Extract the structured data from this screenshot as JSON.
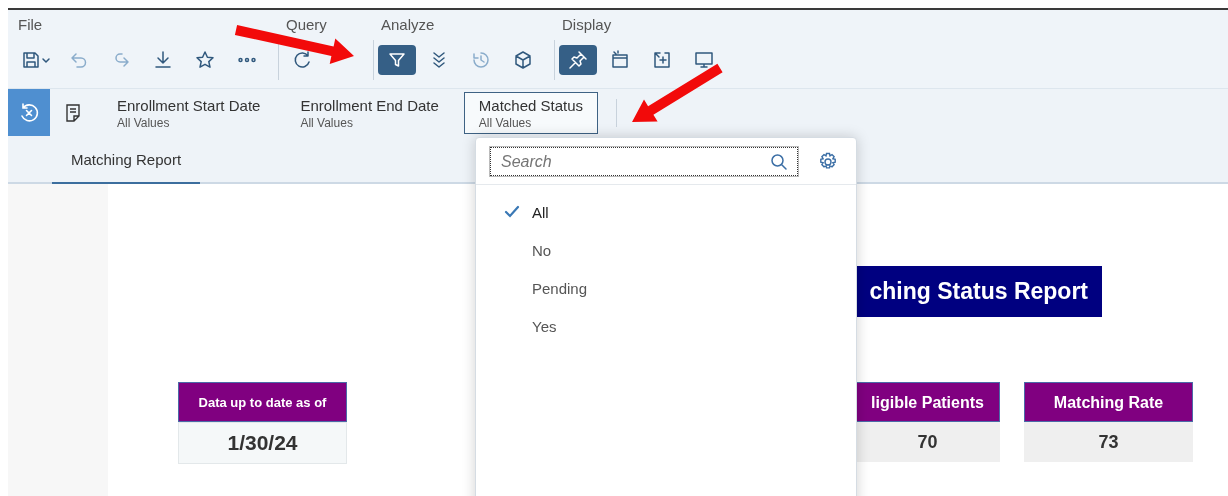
{
  "toolbar": {
    "groups": [
      {
        "label": "File",
        "buttons": [
          {
            "selected": false,
            "disabled": false
          },
          {
            "selected": false,
            "disabled": true
          },
          {
            "selected": false,
            "disabled": true
          },
          {
            "selected": false,
            "disabled": false
          },
          {
            "selected": false,
            "disabled": false
          },
          {
            "selected": false,
            "disabled": false
          }
        ]
      },
      {
        "label": "Query",
        "buttons": [
          {
            "selected": false,
            "disabled": false
          }
        ]
      },
      {
        "label": "Analyze",
        "buttons": [
          {
            "selected": true,
            "disabled": false
          },
          {
            "selected": false,
            "disabled": false
          },
          {
            "selected": false,
            "disabled": true
          },
          {
            "selected": false,
            "disabled": false
          }
        ]
      },
      {
        "label": "Display",
        "buttons": [
          {
            "selected": true,
            "disabled": false
          },
          {
            "selected": false,
            "disabled": false
          },
          {
            "selected": false,
            "disabled": false
          },
          {
            "selected": false,
            "disabled": false
          }
        ]
      }
    ]
  },
  "filters": [
    {
      "label": "Enrollment Start Date",
      "value": "All Values",
      "selected": false
    },
    {
      "label": "Enrollment End Date",
      "value": "All Values",
      "selected": false
    },
    {
      "label": "Matched Status",
      "value": "All Values",
      "selected": true
    }
  ],
  "tabs": [
    {
      "label": "Matching Report",
      "selected": true
    }
  ],
  "dropdown": {
    "search": {
      "placeholder": "Search"
    },
    "options": [
      {
        "label": "All",
        "selected": true
      },
      {
        "label": "No",
        "selected": false
      },
      {
        "label": "Pending",
        "selected": false
      },
      {
        "label": "Yes",
        "selected": false
      }
    ]
  },
  "report": {
    "title": "ching Status Report",
    "date_card": {
      "label": "Data up to date as of",
      "value": "1/30/24"
    },
    "metrics": [
      {
        "label": "ligible Patients",
        "value": "70"
      },
      {
        "label": "Matching Rate",
        "value": "73"
      }
    ]
  }
}
